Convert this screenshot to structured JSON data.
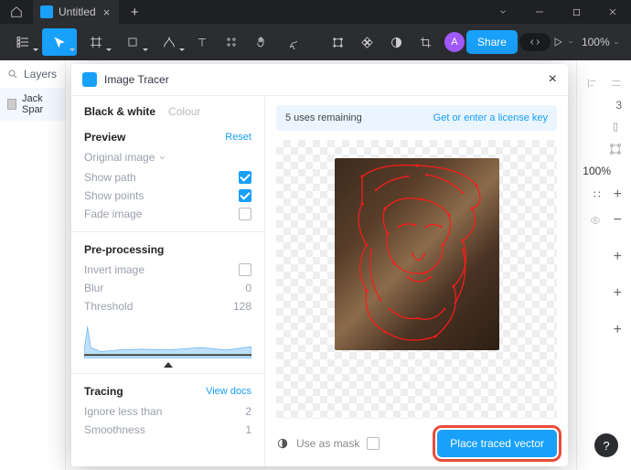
{
  "titlebar": {
    "tab_title": "Untitled"
  },
  "toolbar": {
    "avatar_letter": "A",
    "share_label": "Share",
    "zoom_label": "100%"
  },
  "left_sidebar": {
    "header": "Layers",
    "layer_name": "Jack Spar"
  },
  "panel": {
    "title": "Image Tracer",
    "tabs": {
      "bw": "Black & white",
      "colour": "Colour"
    },
    "preview": {
      "heading": "Preview",
      "reset": "Reset",
      "original_image": "Original image",
      "show_path": "Show path",
      "show_points": "Show points",
      "fade_image": "Fade image"
    },
    "preprocessing": {
      "heading": "Pre-processing",
      "invert_image": "Invert image",
      "blur_label": "Blur",
      "blur_value": "0",
      "threshold_label": "Threshold",
      "threshold_value": "128"
    },
    "tracing": {
      "heading": "Tracing",
      "view_docs": "View docs",
      "ignore_label": "Ignore less than",
      "ignore_value": "2",
      "smooth_label": "Smoothness",
      "smooth_value": "1"
    },
    "banner": {
      "uses": "5 uses remaining",
      "license": "Get or enter a license key"
    },
    "footer": {
      "use_as_mask": "Use as mask",
      "place_button": "Place traced vector"
    }
  },
  "right_sidebar": {
    "text_hint": "3",
    "zoom": "100%"
  },
  "help": "?"
}
